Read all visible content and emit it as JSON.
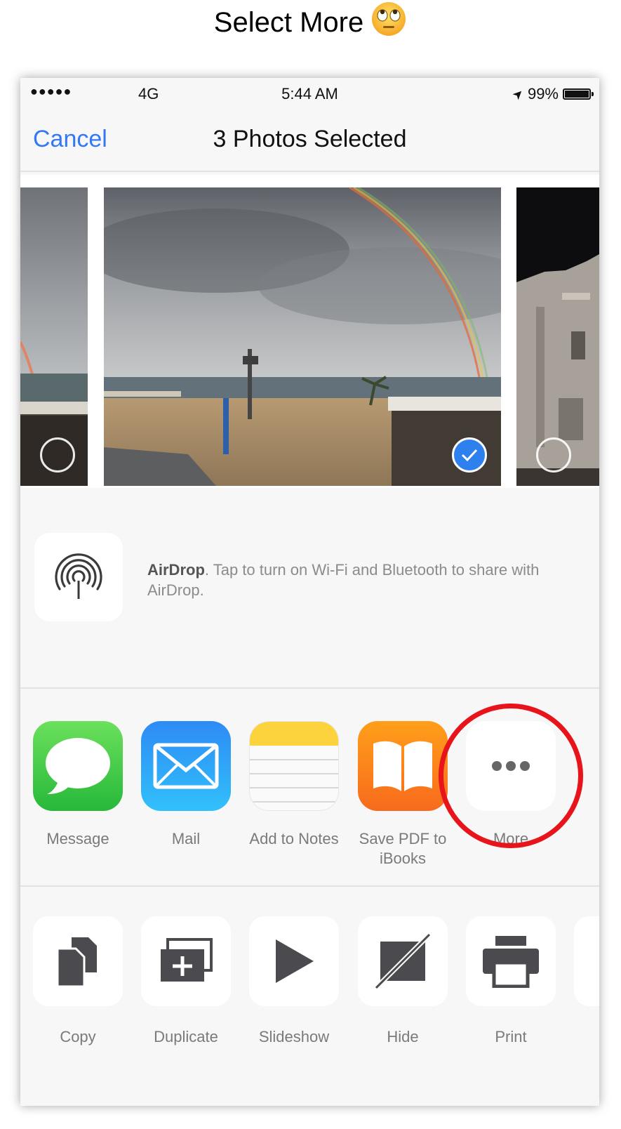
{
  "annotation": {
    "heading": "Select More",
    "emoji": "🙄"
  },
  "status_bar": {
    "signal": "●●●●●",
    "network": "4G",
    "time": "5:44 AM",
    "location": "➤",
    "battery": "99%",
    "battery_level": 0.99
  },
  "nav": {
    "cancel": "Cancel",
    "title": "3 Photos Selected"
  },
  "photos": [
    {
      "selected": false
    },
    {
      "selected": true
    },
    {
      "selected": false
    }
  ],
  "airdrop": {
    "title": "AirDrop",
    "description": ". Tap to turn on Wi-Fi and Bluetooth to share with AirDrop."
  },
  "share_apps": [
    {
      "label": "Message"
    },
    {
      "label": "Mail"
    },
    {
      "label": "Add to Notes"
    },
    {
      "label": "Save PDF to iBooks"
    },
    {
      "label": "More"
    }
  ],
  "actions": [
    {
      "label": "Copy"
    },
    {
      "label": "Duplicate"
    },
    {
      "label": "Slideshow"
    },
    {
      "label": "Hide"
    },
    {
      "label": "Print"
    }
  ],
  "colors": {
    "accent": "#3478f6",
    "highlight": "#e8141b",
    "selected": "#2f80ef"
  }
}
